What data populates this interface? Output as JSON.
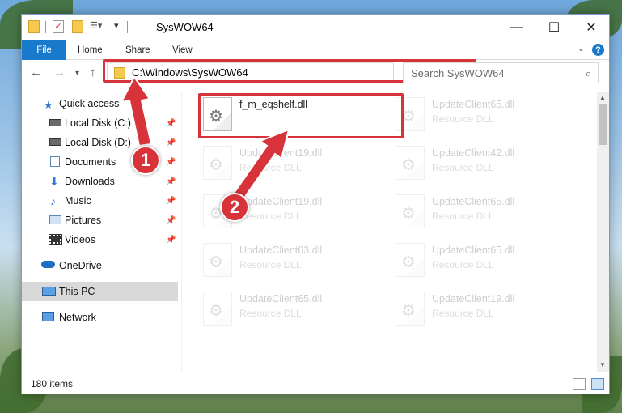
{
  "window": {
    "title": "SysWOW64"
  },
  "ribbon": {
    "tabs": [
      {
        "label": "File"
      },
      {
        "label": "Home"
      },
      {
        "label": "Share"
      },
      {
        "label": "View"
      }
    ]
  },
  "nav": {
    "address": "C:\\Windows\\SysWOW64",
    "search_placeholder": "Search SysWOW64"
  },
  "sidebar": {
    "items": [
      {
        "label": "Quick access"
      },
      {
        "label": "Local Disk (C:)"
      },
      {
        "label": "Local Disk (D:)"
      },
      {
        "label": "Documents"
      },
      {
        "label": "Downloads"
      },
      {
        "label": "Music"
      },
      {
        "label": "Pictures"
      },
      {
        "label": "Videos"
      },
      {
        "label": "OneDrive"
      },
      {
        "label": "This PC"
      },
      {
        "label": "Network"
      }
    ]
  },
  "files": [
    {
      "name": "f_m_eqshelf.dll",
      "type": ""
    },
    {
      "name": "UpdateClient65.dll",
      "type": "Resource DLL"
    },
    {
      "name": "UpdateClient19.dll",
      "type": "Resource DLL"
    },
    {
      "name": "UpdateClient42.dll",
      "type": "Resource DLL"
    },
    {
      "name": "UpdateClient19.dll",
      "type": "Resource DLL"
    },
    {
      "name": "UpdateClient65.dll",
      "type": "Resource DLL"
    },
    {
      "name": "UpdateClient63.dll",
      "type": "Resource DLL"
    },
    {
      "name": "UpdateClient65.dll",
      "type": "Resource DLL"
    },
    {
      "name": "UpdateClient65.dll",
      "type": "Resource DLL"
    },
    {
      "name": "UpdateClient19.dll",
      "type": "Resource DLL"
    }
  ],
  "status": {
    "item_count": "180 items"
  },
  "callouts": {
    "first": "1",
    "second": "2"
  },
  "colors": {
    "accent": "#1979ca",
    "highlight": "#d8333b"
  }
}
